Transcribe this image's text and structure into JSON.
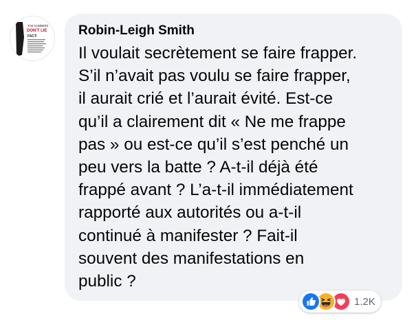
{
  "comment": {
    "author": "Robin-Leigh Smith",
    "text_lines": [
      "Il voulait secrètement se faire frapper.",
      "S’il n’avait pas voulu se faire frapper,",
      "il aurait crié et l’aurait évité. Est-ce",
      "qu’il a clairement dit « Ne me frappe",
      "pas » ou est-ce qu’il s’est penché un",
      "peu vers la batte ? A-t-il déjà été",
      "frappé avant ? L’a-t-il immédiatement",
      "rapporté aux autorités ou a-t-il",
      "continué à manifester ? Fait-il",
      "souvent des manifestations en",
      "public ?"
    ]
  },
  "avatar": {
    "lines": [
      "THE NUMBERS",
      "DON'T LIE",
      "FACT:"
    ]
  },
  "reactions": {
    "icons": [
      "like-icon",
      "haha-icon",
      "love-icon"
    ],
    "count": "1.2K",
    "colors": {
      "like": "#1877f2",
      "haha": "#f7b125",
      "love": "#f33e58"
    }
  }
}
